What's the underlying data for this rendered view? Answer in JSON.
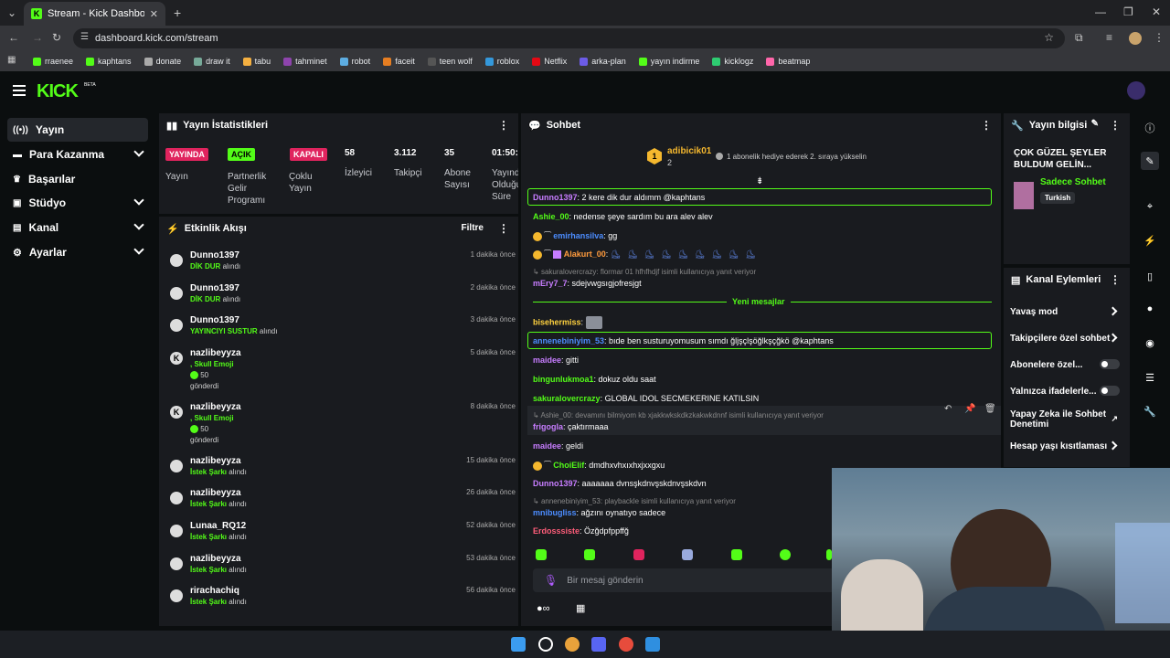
{
  "browser": {
    "tab_title": "Stream - Kick Dashboard",
    "url": "dashboard.kick.com/stream",
    "bookmarks": [
      "rraenee",
      "kaphtans",
      "donate",
      "draw it",
      "tabu",
      "tahminet",
      "robot",
      "faceit",
      "teen wolf",
      "roblox",
      "Netflix",
      "arka-plan",
      "yayın indirme",
      "kicklogz",
      "beatmap"
    ]
  },
  "header": {
    "logo": "KICK",
    "logo_sup": "BETA"
  },
  "sidebar": {
    "items": [
      {
        "label": "Yayın"
      },
      {
        "label": "Para Kazanma"
      },
      {
        "label": "Başarılar"
      },
      {
        "label": "Stüdyo"
      },
      {
        "label": "Kanal"
      },
      {
        "label": "Ayarlar"
      }
    ]
  },
  "stats": {
    "title": "Yayın İstatistikleri",
    "yayinda": "YAYINDA",
    "yayin_label": "Yayın",
    "acik": "AÇIK",
    "partner_label": "Partnerlik Gelir Programı",
    "kapali": "KAPALI",
    "coklu_label": "Çoklu Yayın",
    "viewers": "58",
    "viewers_label": "İzleyici",
    "followers": "3.112",
    "followers_label": "Takipçi",
    "subs": "35",
    "subs_label": "Abone Sayısı",
    "duration": "01:50:",
    "duration_label": "Yayında Olduğu Süre"
  },
  "events": {
    "title": "Etkinlik Akışı",
    "filter": "Filtre",
    "items": [
      {
        "name": "Dunno1397",
        "action": "DİK DUR",
        "suffix": " alındı",
        "time": "1 dakika önce"
      },
      {
        "name": "Dunno1397",
        "action": "DİK DUR",
        "suffix": " alındı",
        "time": "2 dakika önce"
      },
      {
        "name": "Dunno1397",
        "action": "YAYINCIYI SUSTUR",
        "suffix": " alındı",
        "time": "3 dakika önce"
      },
      {
        "name": "nazlibeyyza",
        "action": ", Skull Emoji",
        "amount": "50",
        "suffix2": "gönderdi",
        "time": "5 dakika önce"
      },
      {
        "name": "nazlibeyyza",
        "action": ", Skull Emoji",
        "amount": "50",
        "suffix2": "gönderdi",
        "time": "8 dakika önce"
      },
      {
        "name": "nazlibeyyza",
        "action": "İstek Şarkı",
        "suffix": " alındı",
        "time": "15 dakika önce"
      },
      {
        "name": "nazlibeyyza",
        "action": "İstek Şarkı",
        "suffix": " alındı",
        "time": "26 dakika önce"
      },
      {
        "name": "Lunaa_RQ12",
        "action": "İstek Şarkı",
        "suffix": " alındı",
        "time": "52 dakika önce"
      },
      {
        "name": "nazlibeyyza",
        "action": "İstek Şarkı",
        "suffix": " alındı",
        "time": "53 dakika önce"
      },
      {
        "name": "rirachachiq",
        "action": "İstek Şarkı",
        "suffix": " alındı",
        "time": "56 dakika önce"
      }
    ]
  },
  "chat": {
    "title": "Sohbet",
    "pinned_user": "adibicik01",
    "pinned_rank": "1",
    "pinned_count": "2",
    "pinned_note": "1 abonelik hediye ederek 2. sıraya yükselin",
    "new_messages": "Yeni mesajlar",
    "placeholder": "Bir mesaj gönderin",
    "messages": [
      {
        "user": "Dunno1397",
        "color": "#c77dff",
        "text": "2 kere dik dur aldımm @kaphtans"
      },
      {
        "user": "Ashie_00",
        "color": "#53fc18",
        "text": "nedense şeye sardım bu ara alev alev"
      },
      {
        "user": "emirhansilva",
        "color": "#4c8dff",
        "text": "gg"
      },
      {
        "user": "Alakurt_00",
        "color": "#ff9b3d",
        "text": ""
      },
      {
        "reply": "sakuralovercrazy: flormar 01 hfhfhdjf isimli kullanıcıya yanıt veriyor"
      },
      {
        "user": "mEry7_7",
        "color": "#c77dff",
        "text": "sdejvwgsıgjofresjgt"
      },
      {
        "user": "bisehermiss",
        "color": "#ffd23f",
        "text": ""
      },
      {
        "user": "annenebiniyim_53",
        "color": "#4c8dff",
        "text": "bıde ben susturuyomusum sımdı ğljşçlşöğlkşçğkö @kaphtans"
      },
      {
        "user": "maidee",
        "color": "#c77dff",
        "text": "gitti"
      },
      {
        "user": "bingunlukmoa1",
        "color": "#53fc18",
        "text": "dokuz oldu saat"
      },
      {
        "user": "sakuralovercrazy",
        "color": "#53fc18",
        "text": "GLOBAL IDOL SECMEKERINE KATILSIN"
      },
      {
        "reply": "Ashie_00: devamını bilmiyom kb xjakkwkskdkzkakwkdnnf isimli kullanıcıya yanıt veriyor"
      },
      {
        "user": "frigogla",
        "color": "#c77dff",
        "text": "çaktırmaaa"
      },
      {
        "user": "maidee",
        "color": "#c77dff",
        "text": "geldi"
      },
      {
        "user": "ChoiElif",
        "color": "#53fc18",
        "text": "dmdhxvhxıxhxjxxgxu"
      },
      {
        "user": "Dunno1397",
        "color": "#c77dff",
        "text": "aaaaaaa dvnsşkdnvşskdnvşskdvn"
      },
      {
        "reply": "annenebiniyim_53: playbackle isimli kullanıcıya yanıt veriyor"
      },
      {
        "user": "mnibugliss",
        "color": "#4c8dff",
        "text": "ağzını oynatıyo sadece"
      },
      {
        "user": "Erdosssiste",
        "color": "#ff5d7a",
        "text": "Özğdpfppffğ"
      }
    ]
  },
  "stream_info": {
    "title": "Yayın bilgisi",
    "stream_title": "ÇOK GÜZEL ŞEYLER BULDUM GELİN...",
    "category": "Sadece Sohbet",
    "tag": "Turkish"
  },
  "channel_actions": {
    "title": "Kanal Eylemleri",
    "items": [
      "Yavaş mod",
      "Takipçilere özel sohbet",
      "Abonelere özel...",
      "Yalnızca ifadelerle...",
      "Yapay Zeka ile Sohbet Denetimi",
      "Hesap yaşı kısıtlaması"
    ]
  },
  "colors": {
    "accent": "#53fc18",
    "live": "#e0245e",
    "panel": "#191b1f"
  }
}
